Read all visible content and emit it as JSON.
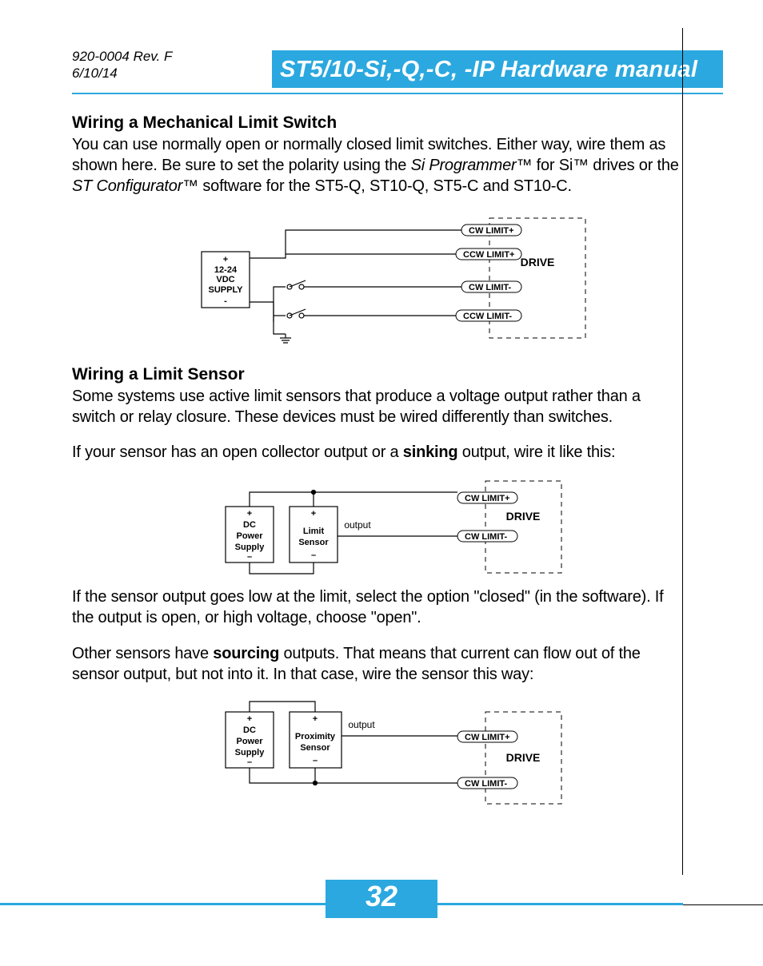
{
  "doc": {
    "rev": "920-0004 Rev. F",
    "date": "6/10/14"
  },
  "title": "ST5/10-Si,-Q,-C, -IP Hardware manual",
  "page_number": "32",
  "sec1": {
    "heading": "Wiring a Mechanical Limit Switch",
    "para_a": "You can use normally open or normally closed limit switches.  Either way, wire them as shown here. Be sure to set the polarity using the ",
    "sw1": "Si Programmer™",
    "para_b": " for Si™ drives or the ",
    "sw2": "ST Configurator™",
    "para_c": " software for the ST5-Q, ST10-Q, ST5-C and ST10-C."
  },
  "sec2": {
    "heading": "Wiring a Limit Sensor",
    "para1": "Some systems use active limit sensors that produce a voltage output rather than a switch or relay closure.  These devices must be wired differently than switches.",
    "para2a": "If your sensor has an open collector output or a ",
    "para2b": "sinking",
    "para2c": " output, wire it like this:",
    "para3": "If the sensor output goes low at the limit, select the option \"closed\" (in the software).  If the output is open, or high voltage, choose \"open\".",
    "para4a": "Other sensors have ",
    "para4b": "sourcing",
    "para4c": " outputs.  That means that current can flow out of the sensor output, but not into it.  In that case, wire the sensor this way:"
  },
  "diag": {
    "supply1_l1": "+",
    "supply1_l2": "12-24",
    "supply1_l3": "VDC",
    "supply1_l4": "SUPPLY",
    "supply1_l5": "-",
    "cwlimp": "CW LIMIT+",
    "ccwlimp": "CCW LIMIT+",
    "cwlimm": "CW LIMIT-",
    "ccwlimm": "CCW LIMIT-",
    "drive": "DRIVE",
    "dc_l1": "+",
    "dc_l2": "DC",
    "dc_l3": "Power",
    "dc_l4": "Supply",
    "dc_l5": "–",
    "ls_l1": "+",
    "ls_l2": "Limit",
    "ls_l3": "Sensor",
    "ls_l4": "–",
    "px_l2": "Proximity",
    "px_l3": "Sensor",
    "output": "output"
  }
}
